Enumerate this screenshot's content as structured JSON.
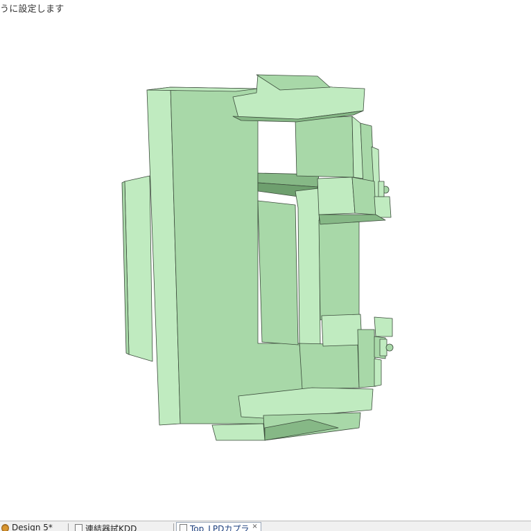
{
  "hint_text": "うに設定します",
  "model": {
    "face_light": "#c0ebc0",
    "face_mid": "#a8d8a8",
    "face_dark": "#86b886",
    "edge": "#3a4a3a"
  },
  "taskbar": {
    "tabs": [
      {
        "label": "Design 5*",
        "icon": "solidworks-icon"
      },
      {
        "label": "連結器試KDD",
        "icon": "document-icon"
      },
      {
        "label": "Top_LPDカプラ",
        "icon": "document-icon",
        "active": true,
        "close": "×"
      }
    ]
  }
}
